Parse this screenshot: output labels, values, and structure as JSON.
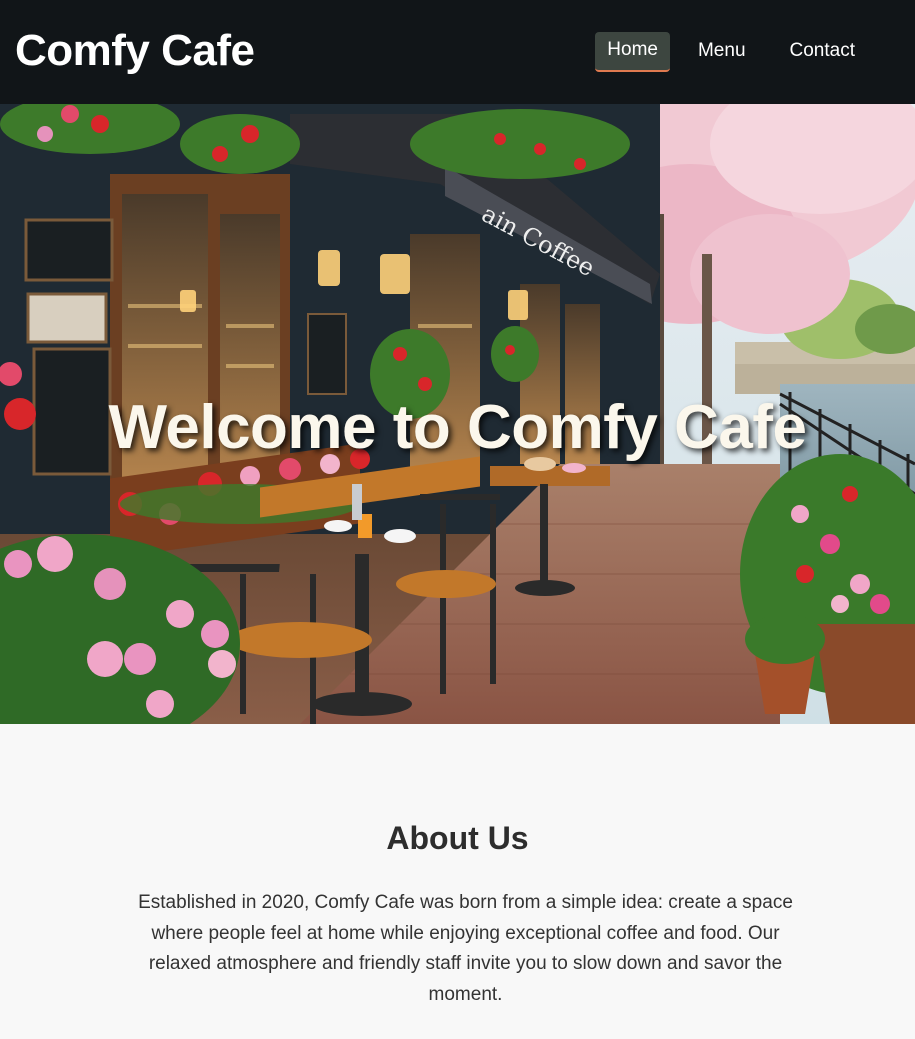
{
  "header": {
    "brand": "Comfy Cafe",
    "nav": [
      {
        "label": "Home",
        "active": true
      },
      {
        "label": "Menu",
        "active": false
      },
      {
        "label": "Contact",
        "active": false
      }
    ]
  },
  "hero": {
    "title": "Welcome to Comfy Cafe",
    "image": "cafe-storefront-street-scene",
    "awning_text": "ain Coffee"
  },
  "about": {
    "title": "About Us",
    "text": "Established in 2020, Comfy Cafe was born from a simple idea: create a space where people feel at home while enjoying exceptional coffee and food. Our relaxed atmosphere and friendly staff invite you to slow down and savor the moment."
  },
  "colors": {
    "header_bg": "#111518",
    "active_nav_bg": "#3d4640",
    "active_nav_underline": "#e07a50",
    "page_bg": "#f8f8f8"
  }
}
